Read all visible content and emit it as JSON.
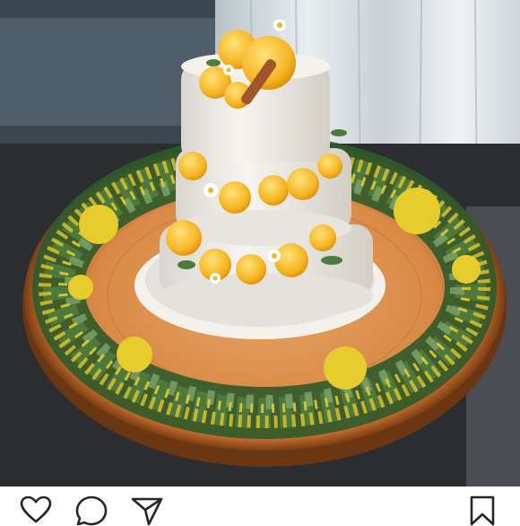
{
  "post": {
    "image_description_icon": "photo",
    "accent_color": "#262626"
  },
  "actions": {
    "like_icon": "heart-outline",
    "comment_icon": "speech-bubble-outline",
    "share_icon": "paper-plane-outline",
    "save_icon": "bookmark-outline"
  }
}
